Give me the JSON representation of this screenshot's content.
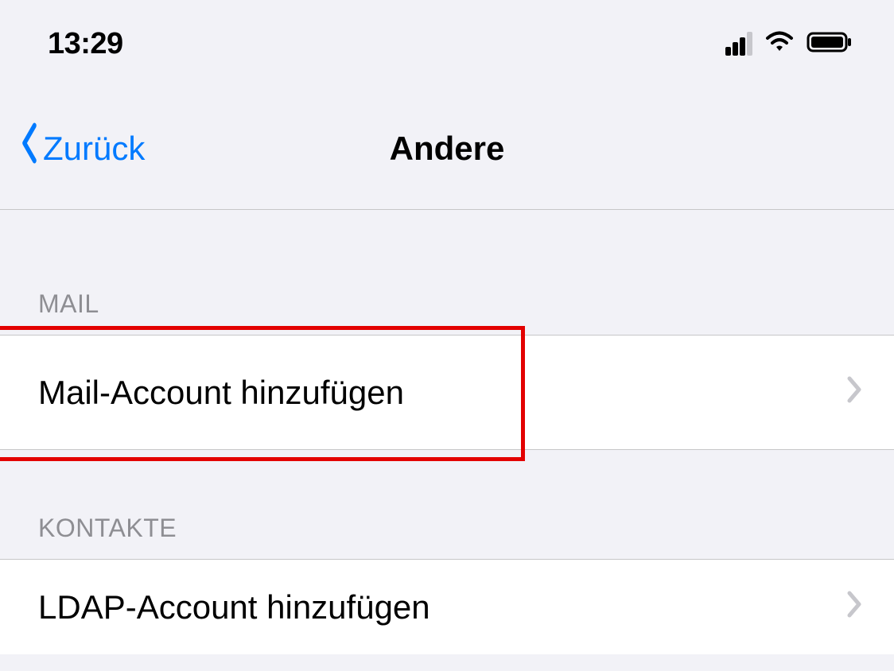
{
  "status": {
    "time": "13:29"
  },
  "nav": {
    "back_label": "Zurück",
    "title": "Andere"
  },
  "sections": [
    {
      "header": "MAIL",
      "items": [
        {
          "label": "Mail-Account hinzufügen",
          "highlighted": true
        }
      ]
    },
    {
      "header": "KONTAKTE",
      "items": [
        {
          "label": "LDAP-Account hinzufügen"
        }
      ]
    }
  ]
}
